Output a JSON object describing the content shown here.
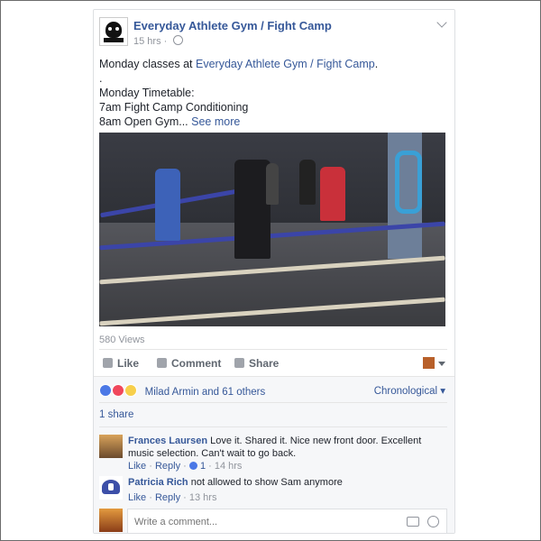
{
  "post": {
    "page_name": "Everyday Athlete Gym / Fight Camp",
    "time": "15 hrs",
    "privacy_icon": "globe-icon",
    "text_prefix": "Monday classes at ",
    "text_link": "Everyday Athlete Gym / Fight Camp",
    "text_suffix": ".",
    "dot": ".",
    "line1": "Monday Timetable:",
    "line2": "7am Fight Camp Conditioning",
    "line3": "8am Open Gym... ",
    "see_more": "See more",
    "views": "580 Views"
  },
  "actions": {
    "like": "Like",
    "comment": "Comment",
    "share": "Share"
  },
  "reactions": {
    "names": "Milad Armin and 61 others",
    "sort": "Chronological",
    "shares": "1 share"
  },
  "comments": [
    {
      "author": "Frances Laursen",
      "text": "Love it. Shared it. Nice new front door. Excellent music selection. Can't wait to go back.",
      "like": "Like",
      "reply": "Reply",
      "likes_count": "1",
      "time": "14 hrs"
    },
    {
      "author": "Patricia Rich",
      "text": "not allowed to show Sam anymore",
      "like": "Like",
      "reply": "Reply",
      "time": "13 hrs"
    }
  ],
  "comment_box": {
    "placeholder": "Write a comment..."
  },
  "colors": {
    "link": "#365899",
    "muted": "#90949c"
  }
}
